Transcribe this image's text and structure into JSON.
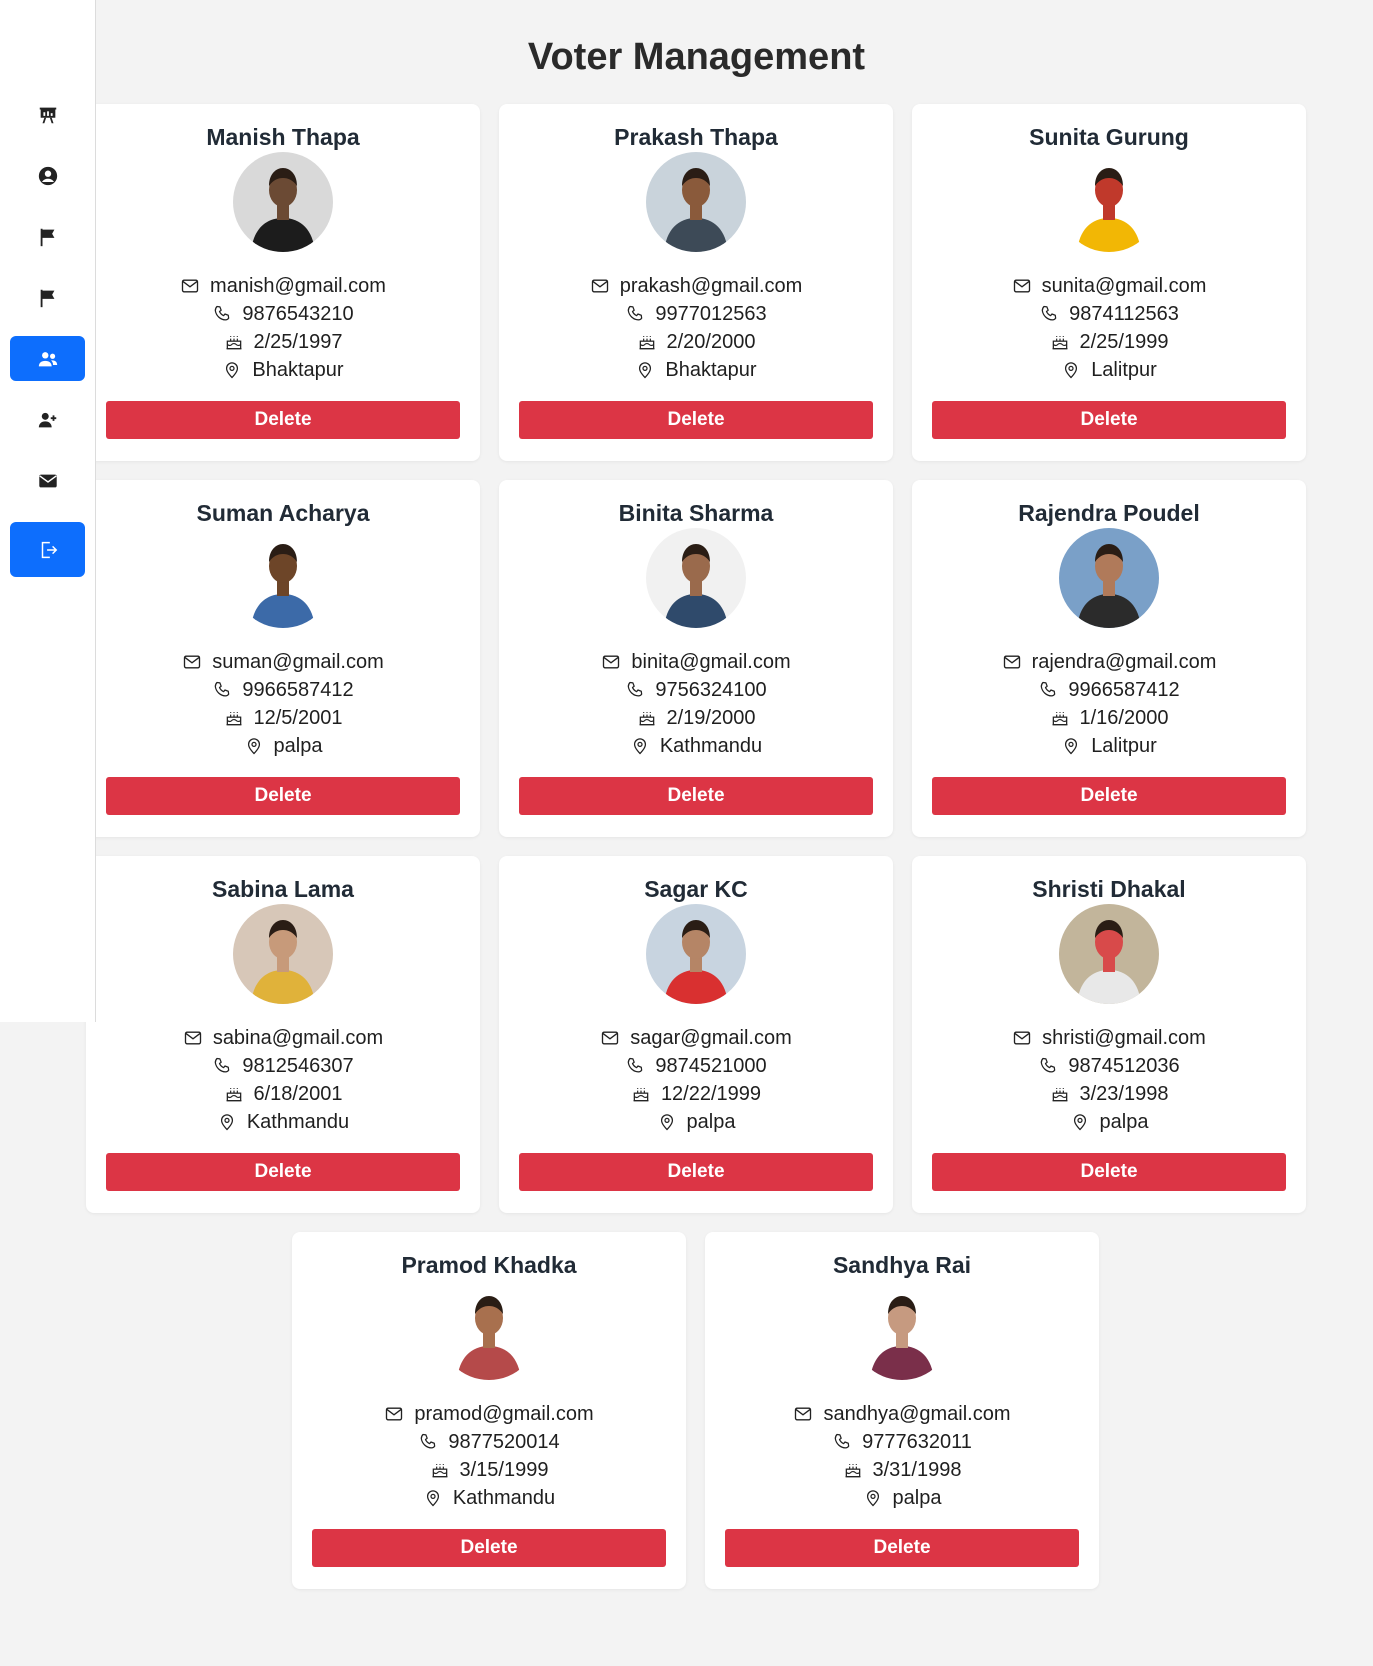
{
  "page": {
    "title": "Voter Management"
  },
  "sidebar": {
    "items": [
      {
        "icon": "presentation-chart-icon",
        "active": false
      },
      {
        "icon": "user-circle-icon",
        "active": false
      },
      {
        "icon": "flag-icon",
        "active": false
      },
      {
        "icon": "flag-icon",
        "active": false
      },
      {
        "icon": "users-icon",
        "active": true
      },
      {
        "icon": "user-plus-icon",
        "active": false
      },
      {
        "icon": "envelope-icon",
        "active": false
      },
      {
        "icon": "logout-icon",
        "active": true
      }
    ]
  },
  "colors": {
    "accent": "#0d6efd",
    "danger": "#dc3545",
    "background": "#f3f3f3",
    "card": "#ffffff"
  },
  "voters": [
    {
      "name": "Manish Thapa",
      "email": "manish@gmail.com",
      "phone": "9876543210",
      "dob": "2/25/1997",
      "address": "Bhaktapur",
      "delete_label": "Delete"
    },
    {
      "name": "Prakash Thapa",
      "email": "prakash@gmail.com",
      "phone": "9977012563",
      "dob": "2/20/2000",
      "address": "Bhaktapur",
      "delete_label": "Delete"
    },
    {
      "name": "Sunita Gurung",
      "email": "sunita@gmail.com",
      "phone": "9874112563",
      "dob": "2/25/1999",
      "address": "Lalitpur",
      "delete_label": "Delete"
    },
    {
      "name": "Suman Acharya",
      "email": "suman@gmail.com",
      "phone": "9966587412",
      "dob": "12/5/2001",
      "address": "palpa",
      "delete_label": "Delete"
    },
    {
      "name": "Binita Sharma",
      "email": "binita@gmail.com",
      "phone": "9756324100",
      "dob": "2/19/2000",
      "address": "Kathmandu",
      "delete_label": "Delete"
    },
    {
      "name": "Rajendra Poudel",
      "email": "rajendra@gmail.com",
      "phone": "9966587412",
      "dob": "1/16/2000",
      "address": "Lalitpur",
      "delete_label": "Delete"
    },
    {
      "name": "Sabina Lama",
      "email": "sabina@gmail.com",
      "phone": "9812546307",
      "dob": "6/18/2001",
      "address": "Kathmandu",
      "delete_label": "Delete"
    },
    {
      "name": "Sagar KC",
      "email": "sagar@gmail.com",
      "phone": "9874521000",
      "dob": "12/22/1999",
      "address": "palpa",
      "delete_label": "Delete"
    },
    {
      "name": "Shristi Dhakal",
      "email": "shristi@gmail.com",
      "phone": "9874512036",
      "dob": "3/23/1998",
      "address": "palpa",
      "delete_label": "Delete"
    },
    {
      "name": "Pramod Khadka",
      "email": "pramod@gmail.com",
      "phone": "9877520014",
      "dob": "3/15/1999",
      "address": "Kathmandu",
      "delete_label": "Delete"
    },
    {
      "name": "Sandhya Rai",
      "email": "sandhya@gmail.com",
      "phone": "9777632011",
      "dob": "3/31/1998",
      "address": "palpa",
      "delete_label": "Delete"
    }
  ]
}
